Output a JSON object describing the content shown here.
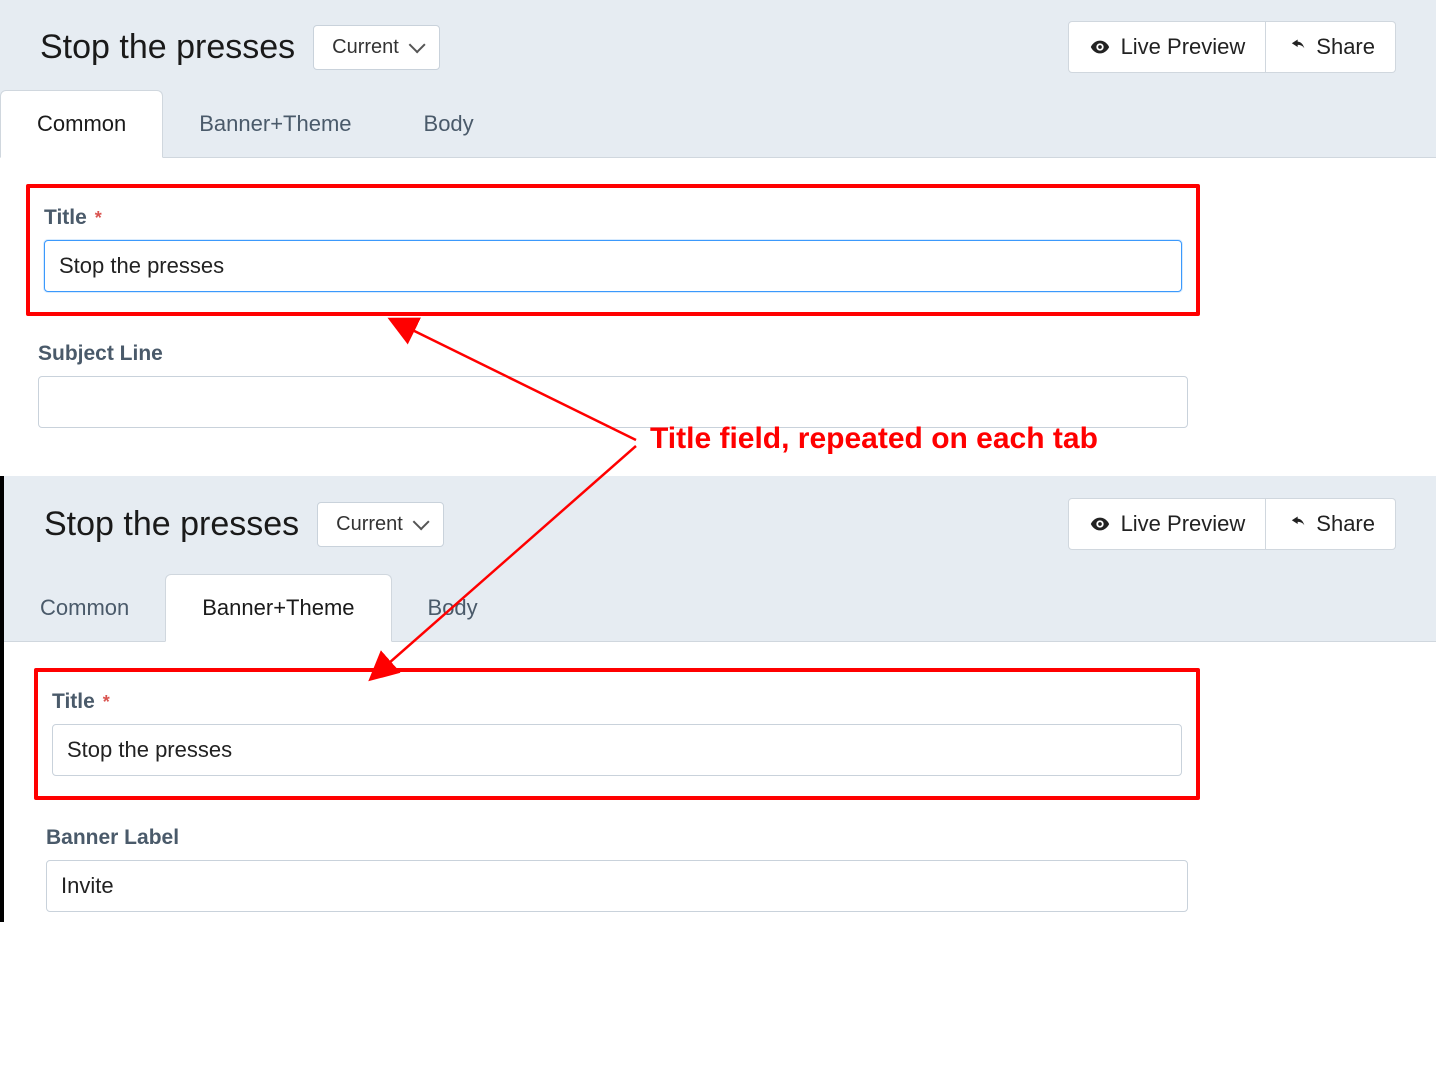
{
  "annotation": {
    "text": "Title field, repeated on each tab"
  },
  "panels": [
    {
      "key": "top",
      "header": {
        "title": "Stop the presses",
        "dropdown_label": "Current",
        "live_preview_label": "Live Preview",
        "share_label": "Share"
      },
      "tabs": [
        {
          "label": "Common",
          "active": true
        },
        {
          "label": "Banner+Theme",
          "active": false
        },
        {
          "label": "Body",
          "active": false
        }
      ],
      "form": {
        "title_label": "Title",
        "title_value": "Stop the presses",
        "second_label": "Subject Line",
        "second_value": ""
      }
    },
    {
      "key": "bottom",
      "header": {
        "title": "Stop the presses",
        "dropdown_label": "Current",
        "live_preview_label": "Live Preview",
        "share_label": "Share"
      },
      "tabs": [
        {
          "label": "Common",
          "active": false
        },
        {
          "label": "Banner+Theme",
          "active": true
        },
        {
          "label": "Body",
          "active": false
        }
      ],
      "form": {
        "title_label": "Title",
        "title_value": "Stop the presses",
        "second_label": "Banner Label",
        "second_value": "Invite"
      }
    }
  ],
  "colors": {
    "highlight": "#ff0000",
    "header_bg": "#e6ecf2",
    "focus": "#3b99fc"
  }
}
